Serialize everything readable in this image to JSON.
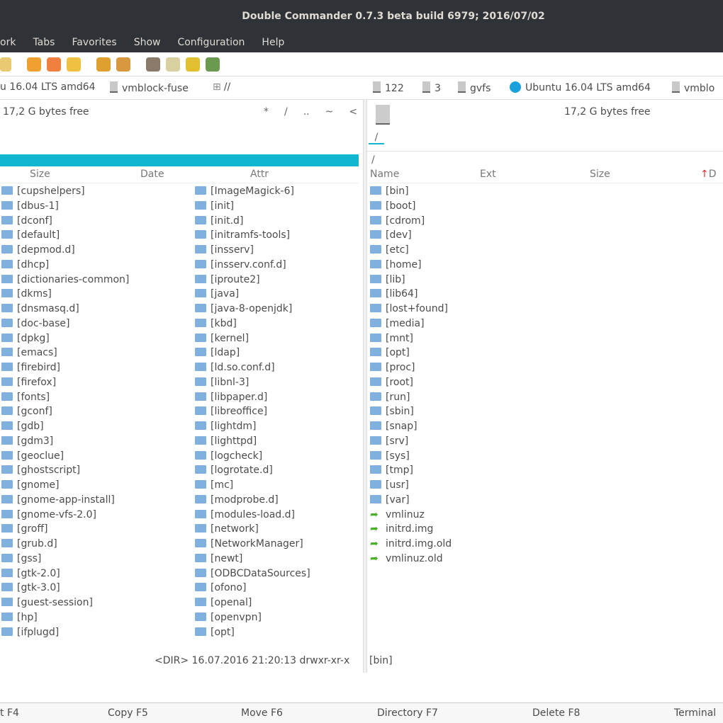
{
  "title": "Double Commander 0.7.3 beta build 6979; 2016/07/02",
  "menu": [
    "ork",
    "Tabs",
    "Favorites",
    "Show",
    "Configuration",
    "Help"
  ],
  "drives_left": [
    "u 16.04 LTS amd64",
    "vmblock-fuse",
    "//"
  ],
  "drives_right": [
    "122",
    "3",
    "gvfs",
    "Ubuntu 16.04 LTS amd64",
    "vmblo"
  ],
  "left": {
    "free": "17,2 G bytes free",
    "nav": [
      "*",
      "/",
      "..",
      "~",
      "<"
    ],
    "headers": [
      "Size",
      "Date",
      "Attr"
    ],
    "col1": [
      "[cupshelpers]",
      "[dbus-1]",
      "[dconf]",
      "[default]",
      "[depmod.d]",
      "[dhcp]",
      "[dictionaries-common]",
      "[dkms]",
      "[dnsmasq.d]",
      "[doc-base]",
      "[dpkg]",
      "[emacs]",
      "[firebird]",
      "[firefox]",
      "[fonts]",
      "[gconf]",
      "[gdb]",
      "[gdm3]",
      "[geoclue]",
      "[ghostscript]",
      "[gnome]",
      "[gnome-app-install]",
      "[gnome-vfs-2.0]",
      "[groff]",
      "[grub.d]",
      "[gss]",
      "[gtk-2.0]",
      "[gtk-3.0]",
      "[guest-session]",
      "[hp]",
      "[ifplugd]"
    ],
    "col2": [
      "[ImageMagick-6]",
      "[init]",
      "[init.d]",
      "[initramfs-tools]",
      "[insserv]",
      "[insserv.conf.d]",
      "[iproute2]",
      "[java]",
      "[java-8-openjdk]",
      "[kbd]",
      "[kernel]",
      "[ldap]",
      "[ld.so.conf.d]",
      "[libnl-3]",
      "[libpaper.d]",
      "[libreoffice]",
      "[lightdm]",
      "[lighttpd]",
      "[logcheck]",
      "[logrotate.d]",
      "[mc]",
      "[modprobe.d]",
      "[modules-load.d]",
      "[network]",
      "[NetworkManager]",
      "[newt]",
      "[ODBCDataSources]",
      "[ofono]",
      "[openal]",
      "[openvpn]",
      "[opt]"
    ],
    "status": "<DIR>  16.07.2016 21:20:13  drwxr-xr-x"
  },
  "right": {
    "free": "17,2 G bytes free",
    "tab": "/",
    "path": "/",
    "headers": [
      "Name",
      "Ext",
      "Size",
      "D"
    ],
    "dirs": [
      "[bin]",
      "[boot]",
      "[cdrom]",
      "[dev]",
      "[etc]",
      "[home]",
      "[lib]",
      "[lib64]",
      "[lost+found]",
      "[media]",
      "[mnt]",
      "[opt]",
      "[proc]",
      "[root]",
      "[run]",
      "[sbin]",
      "[snap]",
      "[srv]",
      "[sys]",
      "[tmp]",
      "[usr]",
      "[var]"
    ],
    "links": [
      "vmlinuz",
      "initrd.img",
      "initrd.img.old",
      "vmlinuz.old"
    ],
    "status": "[bin]"
  },
  "fkeys": [
    "t F4",
    "Copy F5",
    "Move F6",
    "Directory F7",
    "Delete F8",
    "Terminal"
  ],
  "colors": {
    "accent": "#12b6d0",
    "titlebar": "#2f3237"
  }
}
